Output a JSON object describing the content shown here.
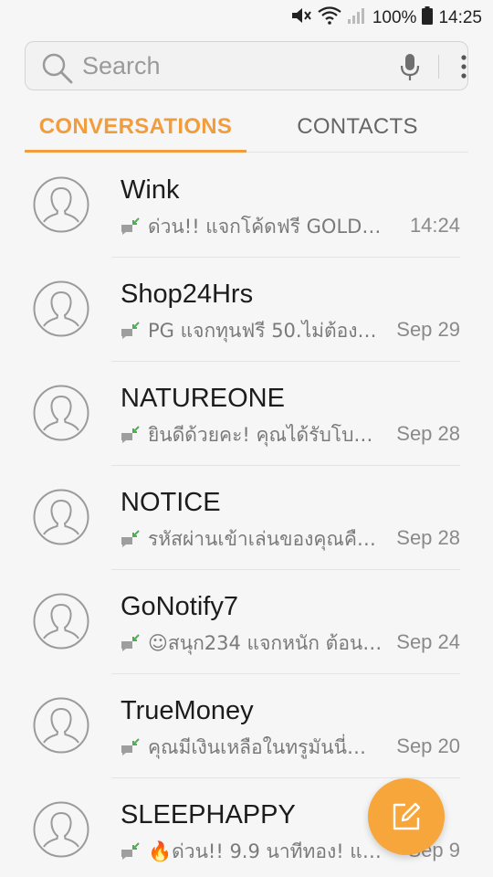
{
  "status_bar": {
    "battery_text": "100%",
    "time": "14:25",
    "icons": [
      "mute-icon",
      "wifi-icon",
      "signal-icon",
      "battery-icon"
    ]
  },
  "search": {
    "placeholder": "Search",
    "icons": [
      "search-icon",
      "mic-icon",
      "more-options-icon"
    ]
  },
  "tabs": [
    {
      "label": "CONVERSATIONS",
      "selected": true
    },
    {
      "label": "CONTACTS",
      "selected": false
    }
  ],
  "conversations": [
    {
      "name": "Wink",
      "preview": "ด่วน!! แจกโค้ดฟรี GOLD-50…",
      "time": "14:24"
    },
    {
      "name": "Shop24Hrs",
      "preview": "PG แจกทุนฟรี 50.ไม่ต้องแ…",
      "time": "Sep 29"
    },
    {
      "name": "NATUREONE",
      "preview": "ยินดีด้วยคะ! คุณได้รับโบนั…",
      "time": "Sep 28"
    },
    {
      "name": "NOTICE",
      "preview": "รหัสผ่านเข้าเล่นของคุณคือ…",
      "time": "Sep 28"
    },
    {
      "name": "GoNotify7",
      "preview": "☺สนุก234 แจกหนัก ต้อน…",
      "time": "Sep 24"
    },
    {
      "name": "TrueMoney",
      "preview": "คุณมีเงินเหลือในทรูมันนี่…",
      "time": "Sep 20"
    },
    {
      "name": "SLEEPHAPPY",
      "preview": "🔥ด่วน!! 9.9 นาทีทอง! แจก…",
      "time": "Sep 9"
    }
  ],
  "colors": {
    "accent": "#f29d3d",
    "fab": "#f6a63b",
    "background": "#f6f6f6",
    "message_icon_green": "#4caf50"
  },
  "fab": {
    "icon": "compose-icon"
  }
}
